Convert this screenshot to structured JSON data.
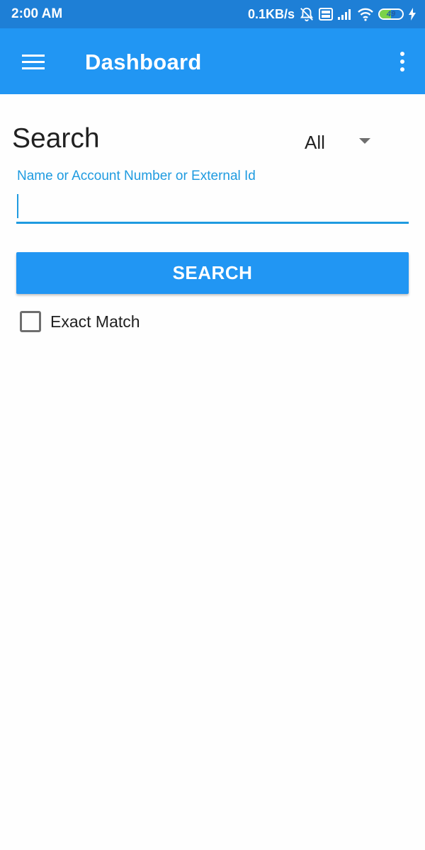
{
  "status_bar": {
    "time": "2:00 AM",
    "net_speed": "0.1KB/s",
    "battery_level": "49",
    "battery_fraction": 0.49,
    "icons": [
      "alarm-off-icon",
      "volte-icon",
      "signal-icon",
      "wifi-icon",
      "battery-icon",
      "charging-icon"
    ]
  },
  "app_bar": {
    "menu_icon": "hamburger-menu-icon",
    "title": "Dashboard",
    "overflow_icon": "more-vert-icon"
  },
  "search": {
    "heading": "Search",
    "type_select": {
      "selected": "All"
    },
    "field_label": "Name or Account Number or External Id",
    "field_value": "",
    "button_label": "SEARCH",
    "exact_match_label": "Exact Match",
    "exact_match_checked": false
  },
  "colors": {
    "status_bar": "#1e7fd6",
    "app_bar": "#2196f3",
    "accent": "#1f9be0",
    "button": "#2196f3",
    "text_primary": "#212121"
  }
}
